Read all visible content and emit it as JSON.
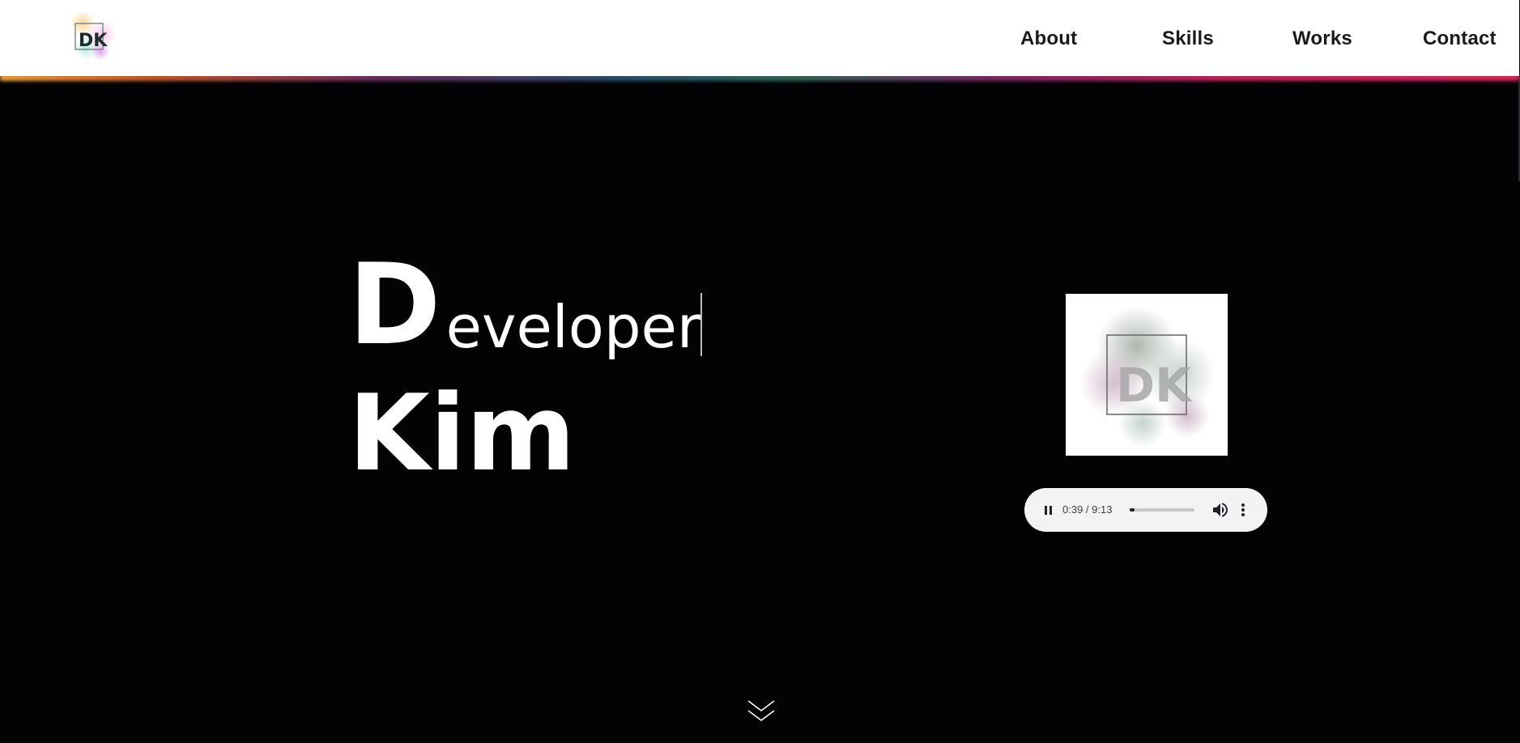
{
  "nav": {
    "about": "About",
    "skills": "Skills",
    "works": "Works",
    "contact": "Contact"
  },
  "logo": {
    "text": "DK",
    "icon": "dk-logo-icon"
  },
  "hero": {
    "big_letter": "D",
    "rest_of_word": "eveloper",
    "line2": "Kim"
  },
  "album": {
    "text": "DK",
    "icon": "album-art-icon"
  },
  "player": {
    "time": "0:39 / 9:13",
    "progress_fraction": 0.071
  },
  "scroll": {
    "icon": "double-chevron-down-icon"
  },
  "colors": {
    "background": "#030306",
    "header_bg": "#ffffff",
    "nav_text": "#1a1a1a",
    "hero_text": "#ffffff",
    "player_bg": "#f1f3f4"
  }
}
